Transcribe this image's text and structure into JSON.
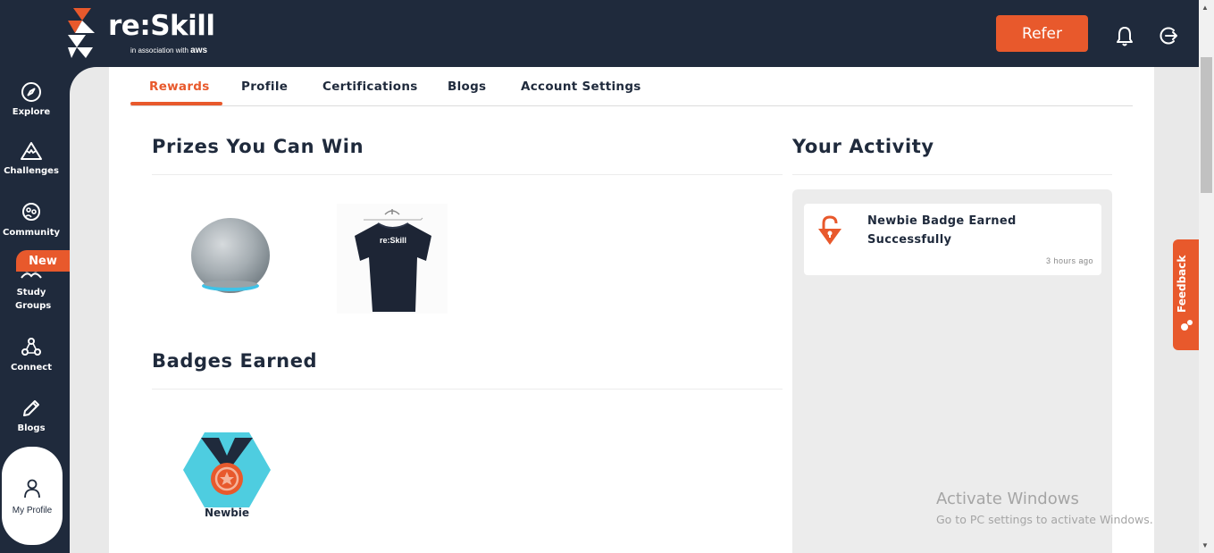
{
  "app": {
    "logo_text": "re:Skill",
    "logo_sub_prefix": "in association with",
    "logo_sub_brand": "aws"
  },
  "header": {
    "refer_label": "Refer",
    "icons": [
      "bell-icon",
      "logout-icon"
    ]
  },
  "sidebar": {
    "items": [
      {
        "label": "Explore",
        "icon": "compass-icon"
      },
      {
        "label": "Challenges",
        "icon": "mountain-icon"
      },
      {
        "label": "Community",
        "icon": "community-icon"
      },
      {
        "label": "Study Groups",
        "icon": "group-icon",
        "badge": "New"
      },
      {
        "label": "Connect",
        "icon": "connect-icon"
      },
      {
        "label": "Blogs",
        "icon": "pencil-icon"
      }
    ],
    "profile_label": "My Profile"
  },
  "tabs": {
    "items": [
      "Rewards",
      "Profile",
      "Certifications",
      "Blogs",
      "Account Settings"
    ],
    "active": "Rewards"
  },
  "prizes": {
    "title": "Prizes You Can Win",
    "items": [
      "echo-speaker",
      "reskill-tshirt"
    ],
    "shirt_text": "re:Skill"
  },
  "badges": {
    "title": "Badges Earned",
    "items": [
      {
        "label": "Newbie"
      }
    ]
  },
  "activity": {
    "title": "Your Activity",
    "items": [
      {
        "text": "Newbie Badge Earned Successfully",
        "time": "3 hours ago"
      }
    ]
  },
  "feedback": {
    "label": "Feedback"
  },
  "watermark": {
    "title": "Activate Windows",
    "subtitle": "Go to PC settings to activate Windows."
  },
  "colors": {
    "navy": "#1f2a3c",
    "accent": "#e8592c",
    "badge_teal": "#4ecde0"
  }
}
